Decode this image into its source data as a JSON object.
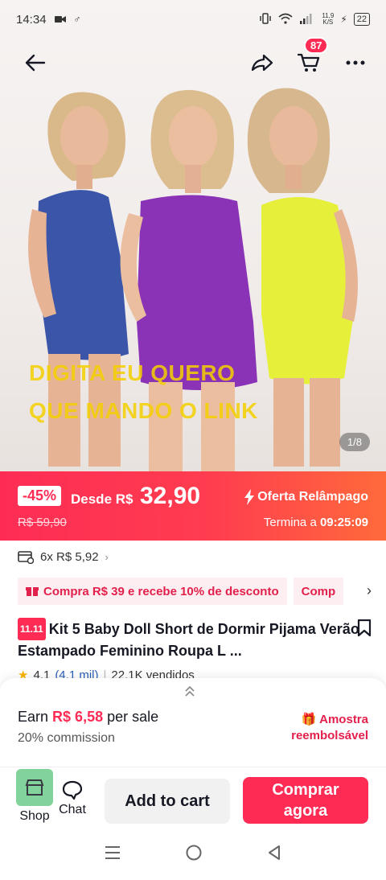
{
  "status_bar": {
    "time": "14:34",
    "net_speed_value": "11,9",
    "net_speed_unit": "K/S",
    "battery": "22"
  },
  "nav": {
    "cart_count": "87"
  },
  "hero": {
    "overlay_line1": "DIGITA EU QUERO",
    "overlay_line2": "QUE MANDO O LINK",
    "page_indicator": "1/8",
    "outfit_colors": [
      "#3b55a8",
      "#8a33b6",
      "#e6ef3a"
    ]
  },
  "flash": {
    "discount": "-45%",
    "from_label": "Desde R$",
    "price": "32,90",
    "old_price": "R$ 59,90",
    "label": "Oferta Relâmpago",
    "ends_label": "Termina a",
    "ends_time": "09:25:09",
    "colors": {
      "primary": "#fe2c55",
      "secondary": "#ff6a3b"
    }
  },
  "installments": {
    "text": "6x R$ 5,92"
  },
  "promos": [
    {
      "label": "Compra R$ 39 e recebe 10% de desconto"
    },
    {
      "label": "Comp"
    }
  ],
  "product": {
    "sale_tag": "11.11",
    "title": "Kit 5 Baby Doll Short de Dormir Pijama Verão Estampado Feminino Roupa L ..."
  },
  "rating": {
    "score": "4.1",
    "reviews": "(4.1 mil)",
    "separator": "|",
    "sold": "22.1K vendidos"
  },
  "affiliate": {
    "earn_prefix": "Earn",
    "earn_amount": "R$ 6,58",
    "earn_suffix": "per sale",
    "commission": "20% commission",
    "sample_line1": "Amostra",
    "sample_line2": "reembolsável"
  },
  "actions": {
    "shop": "Shop",
    "chat": "Chat",
    "add_to_cart": "Add to cart",
    "buy_line1": "Comprar",
    "buy_line2": "agora"
  }
}
